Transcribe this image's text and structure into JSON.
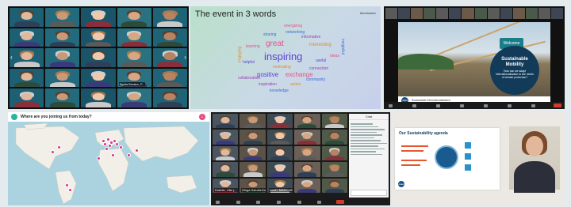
{
  "collage": {
    "bg": "#e4ebef"
  },
  "panel_top_left": {
    "tile_bg": [
      "#1d5f73",
      "#236b7c",
      "#1a5468",
      "#2a7282",
      "#1f6377"
    ],
    "tiles": [
      {
        "name": ""
      },
      {
        "name": ""
      },
      {
        "name": ""
      },
      {
        "name": ""
      },
      {
        "name": ""
      },
      {
        "name": ""
      },
      {
        "name": ""
      },
      {
        "name": ""
      },
      {
        "name": ""
      },
      {
        "name": ""
      },
      {
        "name": ""
      },
      {
        "name": ""
      },
      {
        "name": ""
      },
      {
        "name": ""
      },
      {
        "name": ""
      },
      {
        "name": ""
      },
      {
        "name": ""
      },
      {
        "name": ""
      },
      {
        "name": "Agata Bruska, P..."
      },
      {
        "name": ""
      },
      {
        "name": ""
      },
      {
        "name": ""
      },
      {
        "name": ""
      },
      {
        "name": ""
      },
      {
        "name": ""
      }
    ]
  },
  "panel_top_mid": {
    "title": "The event in 3 words",
    "brand": "Mentimeter",
    "words": {
      "big": "inspiring",
      "w2": "great",
      "w3": "exchange",
      "w4": "positive",
      "w5": "informative",
      "w6": "networking",
      "w7": "interesting",
      "w8": "sharing",
      "w9": "helpful",
      "w10": "inspiration",
      "w11": "useful",
      "w12": "action",
      "w13": "community",
      "w14": "ideas",
      "w15": "knowledge",
      "w16": "connection",
      "w17": "motivating",
      "w18": "learning",
      "w19": "engaging",
      "w20": "insightful",
      "w21": "energizing",
      "w22": "collaboration"
    }
  },
  "panel_top_right": {
    "welcome": "Welcome",
    "slide_title": "Sustainable Mobility",
    "slide_sub": "How can we adapt internationalisation to the needs of climate protection?",
    "footer": "Sustainable Internationalisation",
    "logo": "daad"
  },
  "panel_bottom_left": {
    "title": "Where are you joining us from today?",
    "subtitle": "",
    "badge": "1",
    "pin_color": "#d63384"
  },
  "panel_bottom_mid": {
    "chat_title": "Chat",
    "tiles": [
      {
        "name": ""
      },
      {
        "name": ""
      },
      {
        "name": ""
      },
      {
        "name": ""
      },
      {
        "name": ""
      },
      {
        "name": ""
      },
      {
        "name": ""
      },
      {
        "name": ""
      },
      {
        "name": ""
      },
      {
        "name": ""
      },
      {
        "name": ""
      },
      {
        "name": ""
      },
      {
        "name": ""
      },
      {
        "name": ""
      },
      {
        "name": ""
      },
      {
        "name": ""
      },
      {
        "name": ""
      },
      {
        "name": ""
      },
      {
        "name": ""
      },
      {
        "name": ""
      },
      {
        "name": "Dobritz, Ulla (..."
      },
      {
        "name": "Kinga Sztuka-Kowalska"
      },
      {
        "name": "Zeich, MARCHEE..."
      },
      {
        "name": ""
      },
      {
        "name": ""
      }
    ]
  },
  "panel_bottom_right": {
    "slide_title": "Our Sustainability agenda",
    "logo": "daad"
  }
}
